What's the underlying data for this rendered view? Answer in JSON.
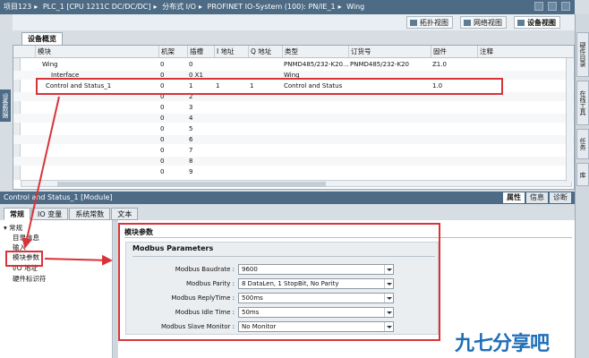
{
  "breadcrumb": [
    "项目123",
    "PLC_1 [CPU 1211C DC/DC/DC]",
    "分布式 I/O",
    "PROFINET IO-System (100): PN/IE_1",
    "Wing"
  ],
  "views": {
    "topology": "拓扑视图",
    "network": "网络视图",
    "device": "设备视图"
  },
  "right_tabs": [
    "硬件目录",
    "在线工具",
    "任务",
    "库"
  ],
  "left_tab": "设备数据",
  "overview_tab": "设备概览",
  "columns": [
    "模块",
    "机架",
    "插槽",
    "I 地址",
    "Q 地址",
    "类型",
    "订货号",
    "固件",
    "注释"
  ],
  "rows": [
    {
      "module": "Wing",
      "rack": "0",
      "slot": "0",
      "i": "",
      "q": "",
      "type": "PNMD485/232-K20...",
      "order": "PNMD485/232-K20",
      "fw": "Z1.0"
    },
    {
      "module": "Interface",
      "rack": "0",
      "slot": "0 X1",
      "i": "",
      "q": "",
      "type": "Wing",
      "order": "",
      "fw": ""
    },
    {
      "module": "Control and Status_1",
      "rack": "0",
      "slot": "1",
      "i": "1",
      "q": "1",
      "type": "Control and Status",
      "order": "",
      "fw": "1.0"
    },
    {
      "module": "",
      "rack": "0",
      "slot": "2",
      "i": "",
      "q": "",
      "type": "",
      "order": "",
      "fw": ""
    },
    {
      "module": "",
      "rack": "0",
      "slot": "3",
      "i": "",
      "q": "",
      "type": "",
      "order": "",
      "fw": ""
    },
    {
      "module": "",
      "rack": "0",
      "slot": "4",
      "i": "",
      "q": "",
      "type": "",
      "order": "",
      "fw": ""
    },
    {
      "module": "",
      "rack": "0",
      "slot": "5",
      "i": "",
      "q": "",
      "type": "",
      "order": "",
      "fw": ""
    },
    {
      "module": "",
      "rack": "0",
      "slot": "6",
      "i": "",
      "q": "",
      "type": "",
      "order": "",
      "fw": ""
    },
    {
      "module": "",
      "rack": "0",
      "slot": "7",
      "i": "",
      "q": "",
      "type": "",
      "order": "",
      "fw": ""
    },
    {
      "module": "",
      "rack": "0",
      "slot": "8",
      "i": "",
      "q": "",
      "type": "",
      "order": "",
      "fw": ""
    },
    {
      "module": "",
      "rack": "0",
      "slot": "9",
      "i": "",
      "q": "",
      "type": "",
      "order": "",
      "fw": ""
    }
  ],
  "inspector": {
    "title": "Control and Status_1 [Module]",
    "props": {
      "properties": "属性",
      "info": "信息",
      "diagnostics": "诊断"
    },
    "tabs": [
      "常规",
      "IO 变量",
      "系统常数",
      "文本"
    ],
    "nav": [
      "常规",
      "目录信息",
      "输入",
      "模块参数",
      "I/O 地址",
      "硬件标识符"
    ],
    "section_title": "模块参数",
    "group_title": "Modbus Parameters",
    "params": [
      {
        "label": "Modbus Baudrate :",
        "value": "9600"
      },
      {
        "label": "Modbus Parity :",
        "value": "8 DataLen, 1 StopBit, No Parity"
      },
      {
        "label": "Modbus ReplyTime :",
        "value": "500ms"
      },
      {
        "label": "Modbus Idle Time :",
        "value": "50ms"
      },
      {
        "label": "Modbus Slave Monitor :",
        "value": "No Monitor"
      }
    ]
  },
  "watermark": "九七分享吧",
  "colors": {
    "highlight": "#d9333a",
    "titlebar": "#4d6b85",
    "watermark": "#1f6fb8"
  }
}
